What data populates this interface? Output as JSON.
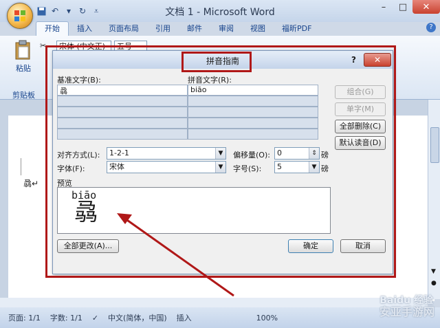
{
  "window": {
    "title": "文档 1 - Microsoft Word",
    "tabs": [
      "开始",
      "插入",
      "页面布局",
      "引用",
      "邮件",
      "审阅",
      "视图",
      "福昕PDF"
    ],
    "active_tab": "开始",
    "font_name": "宋体 (中文正)",
    "font_size": "五号"
  },
  "ribbon": {
    "paste_label": "粘贴",
    "clipboard_label": "剪贴板"
  },
  "document": {
    "glyph": "骉↵"
  },
  "dialog": {
    "title": "拼音指南",
    "help": "?",
    "base_text_label": "基准文字(B):",
    "ruby_text_label": "拼音文字(R):",
    "rows": [
      {
        "base": "骉",
        "ruby": "biāo"
      },
      {
        "base": "",
        "ruby": ""
      },
      {
        "base": "",
        "ruby": ""
      },
      {
        "base": "",
        "ruby": ""
      },
      {
        "base": "",
        "ruby": ""
      }
    ],
    "buttons": {
      "group": "组合(G)",
      "mono": "单字(M)",
      "clear_all": "全部删除(C)",
      "default_reading": "默认读音(D)",
      "change_all": "全部更改(A)...",
      "ok": "确定",
      "cancel": "取消"
    },
    "alignment_label": "对齐方式(L):",
    "alignment_value": "1-2-1",
    "offset_label": "偏移量(O):",
    "offset_value": "0",
    "offset_unit": "磅",
    "font_label": "字体(F):",
    "font_value": "宋体",
    "size_label": "字号(S):",
    "size_value": "5",
    "size_unit": "磅",
    "preview_label": "预览",
    "preview_ruby": "biāo",
    "preview_base": "骉"
  },
  "statusbar": {
    "page": "页面: 1/1",
    "words": "字数: 1/1",
    "language": "中文(简体，中国)",
    "mode": "插入",
    "zoom": "100%"
  },
  "watermark": {
    "text1": "Baidu 经验",
    "text2": "安亚手游网"
  },
  "colors": {
    "annotation_red": "#b01818",
    "ribbon_blue": "#15428b"
  }
}
